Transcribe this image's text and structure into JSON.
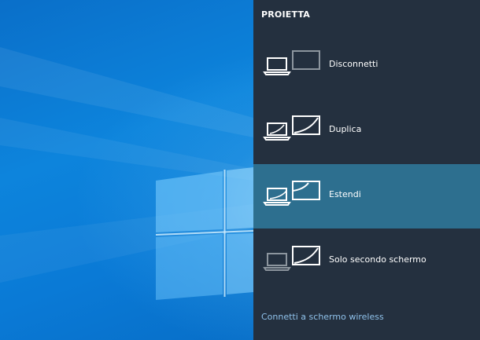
{
  "panel": {
    "title": "PROIETTA",
    "options": [
      {
        "label": "Disconnetti",
        "icon": "pc-screen-only-icon",
        "selected": false
      },
      {
        "label": "Duplica",
        "icon": "duplicate-icon",
        "selected": false
      },
      {
        "label": "Estendi",
        "icon": "extend-icon",
        "selected": true
      },
      {
        "label": "Solo secondo schermo",
        "icon": "second-screen-only-icon",
        "selected": false
      }
    ],
    "wireless_link": "Connetti a schermo wireless"
  },
  "colors": {
    "panel_bg": "#24303f",
    "selected_bg": "#2d6f8f",
    "link": "#8fc1ea",
    "desktop": "#0a7ad6"
  }
}
